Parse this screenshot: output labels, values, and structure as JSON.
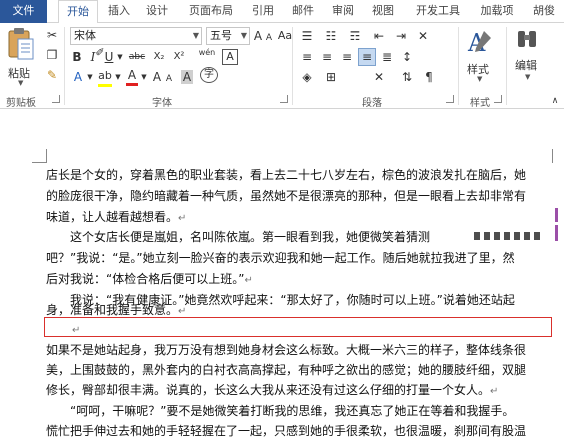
{
  "tabs": [
    {
      "label": "文件"
    },
    {
      "label": "开始"
    },
    {
      "label": "插入"
    },
    {
      "label": "设计"
    },
    {
      "label": "页面布局"
    },
    {
      "label": "引用"
    },
    {
      "label": "邮件"
    },
    {
      "label": "审阅"
    },
    {
      "label": "视图"
    },
    {
      "label": "开发工具"
    },
    {
      "label": "加载项"
    },
    {
      "label": "胡俊"
    }
  ],
  "ribbon": {
    "clipboard": {
      "paste_label": "粘贴",
      "group_label": "剪贴板"
    },
    "font": {
      "font_name": "宋体",
      "font_size": "五号",
      "group_label": "字体",
      "grow_label": "A",
      "shrink_label": "A",
      "aa_label": "Aa",
      "clear_label": "A",
      "pinyin_label": "wén",
      "border_label": "A",
      "bold": "B",
      "italic": "I",
      "underline": "U",
      "strike": "abc",
      "sub": "X₂",
      "sup": "X²",
      "font_color": "A",
      "char_shade": "A",
      "enclose": "字"
    },
    "paragraph": {
      "group_label": "段落"
    },
    "styles": {
      "label": "样式",
      "group_label": "样式"
    },
    "editing": {
      "label": "编辑"
    }
  },
  "document": {
    "lines": [
      "店长是个女的，穿着黑色的职业套装，看上去二十七八岁左右，棕色的波浪发扎在脑后，她",
      "的脸庞很干净，隐约暗藏着一种气质，虽然她不是很漂亮的那种，但是一眼看上去却非常有",
      "味道，让人越看越想看。",
      "　　这个女店长便是嵐姐，名叫陈依嵐。第一眼看到我，她便微笑着猜测",
      "吧？”我说：“是。”她立刻一脸兴奋的表示欢迎我和她一起工作。随后她就拉我进了里，然",
      "后对我说：“体检合格后便可以上班。”",
      "　　我说：“我有健康证。”她竟然欢呼起来：“那太好了，你随时可以上班。”说着她还站起",
      "身，准备和我握手致意。",
      "",
      "如果不是她站起身，我万万没有想到她身材会这么标致。大概一米六三的样子，整体线条很",
      "美，上围鼓鼓的，黑外套内的白衬衣高高撑起，有种呼之欲出的感觉；她的腰肢纤细，双腿",
      "修长，臀部却很丰满。说真的，长这么大我从来还没有过这么仔细的打量一个女人。",
      "　　“呵呵，干嘛呢？”要不是她微笑着打断我的思维，我还真忘了她正在等着和我握手。",
      "慌忙把手伸过去和她的手轻轻握在了一起，只感到她的手很柔软，也很温暖，刹那间有股温"
    ]
  },
  "colors": {
    "accent": "#2b579a",
    "highlight_box": "#d9302c"
  }
}
